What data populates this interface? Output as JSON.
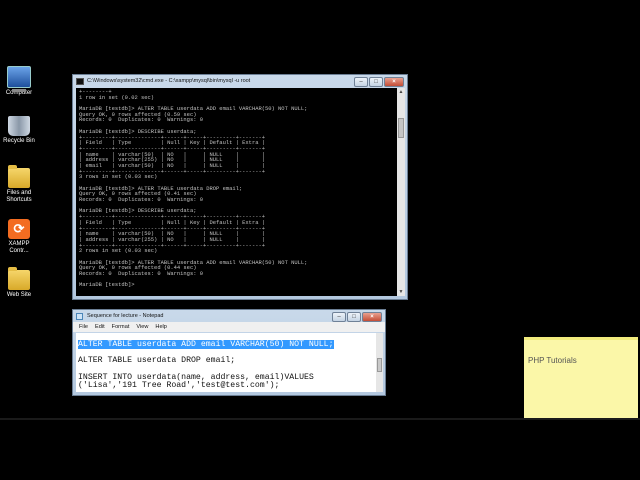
{
  "desktop": {
    "icons": [
      {
        "label": "Computer",
        "icon": "computer-icon"
      },
      {
        "label": "Recycle Bin",
        "icon": "recycle-bin-icon"
      },
      {
        "label": "Files and Shortcuts",
        "icon": "folder-icon"
      },
      {
        "label": "XAMPP Contr...",
        "icon": "xampp-icon"
      },
      {
        "label": "Web Site",
        "icon": "folder-icon"
      }
    ]
  },
  "cmd": {
    "title": "C:\\Windows\\system32\\cmd.exe - C:\\xampp\\mysql\\bin\\mysql -u root",
    "lines": [
      "+--------+",
      "1 row in set (0.02 sec)",
      "",
      "MariaDB [testdb]> ALTER TABLE userdata ADD email VARCHAR(50) NOT NULL;",
      "Query OK, 0 rows affected (0.59 sec)",
      "Records: 0  Duplicates: 0  Warnings: 0",
      "",
      "MariaDB [testdb]> DESCRIBE userdata;",
      "+---------+--------------+------+-----+---------+-------+",
      "| Field   | Type         | Null | Key | Default | Extra |",
      "+---------+--------------+------+-----+---------+-------+",
      "| name    | varchar(50)  | NO   |     | NULL    |       |",
      "| address | varchar(255) | NO   |     | NULL    |       |",
      "| email   | varchar(50)  | NO   |     | NULL    |       |",
      "+---------+--------------+------+-----+---------+-------+",
      "3 rows in set (0.03 sec)",
      "",
      "MariaDB [testdb]> ALTER TABLE userdata DROP email;",
      "Query OK, 0 rows affected (0.41 sec)",
      "Records: 0  Duplicates: 0  Warnings: 0",
      "",
      "MariaDB [testdb]> DESCRIBE userdata;",
      "+---------+--------------+------+-----+---------+-------+",
      "| Field   | Type         | Null | Key | Default | Extra |",
      "+---------+--------------+------+-----+---------+-------+",
      "| name    | varchar(50)  | NO   |     | NULL    |       |",
      "| address | varchar(255) | NO   |     | NULL    |       |",
      "+---------+--------------+------+-----+---------+-------+",
      "2 rows in set (0.03 sec)",
      "",
      "MariaDB [testdb]> ALTER TABLE userdata ADD email VARCHAR(50) NOT NULL;",
      "Query OK, 0 rows affected (0.44 sec)",
      "Records: 0  Duplicates: 0  Warnings: 0",
      "",
      "MariaDB [testdb]>"
    ]
  },
  "notepad": {
    "title": "Sequence for lecture - Notepad",
    "menu": [
      "File",
      "Edit",
      "Format",
      "View",
      "Help"
    ],
    "selected_line": "ALTER TABLE userdata ADD email VARCHAR(50) NOT NULL;",
    "lines": [
      "",
      "ALTER TABLE userdata DROP email;",
      "",
      "INSERT INTO userdata(name, address, email)VALUES",
      "('Lisa','191 Tree Road','test@test.com');"
    ]
  },
  "sticky_note": {
    "text": "PHP Tutorials"
  },
  "colors": {
    "console_bg": "#000000",
    "console_fg": "#c0c0c0",
    "selection": "#3399ff",
    "sticky": "#fbf7a8"
  }
}
